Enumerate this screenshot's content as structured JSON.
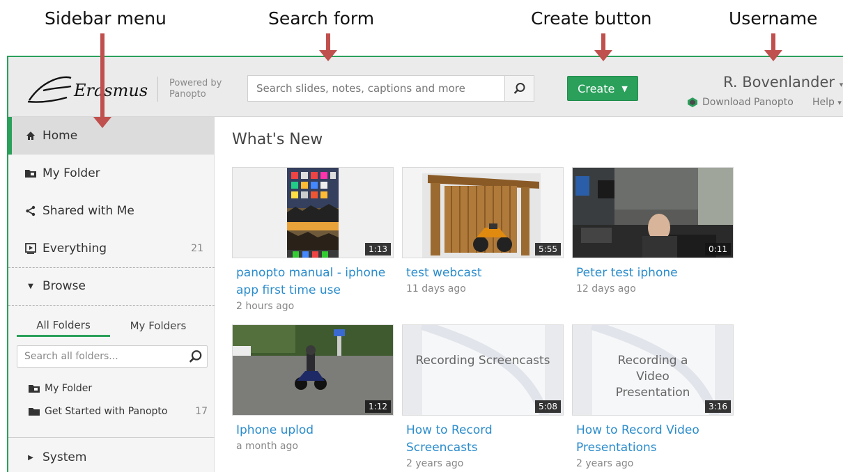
{
  "callouts": {
    "sidebar_menu": "Sidebar menu",
    "search_form": "Search form",
    "create_button": "Create button",
    "username": "Username"
  },
  "colors": {
    "accent": "#2aa05b",
    "link": "#2a8ccc",
    "callout_arrow": "#c0504d"
  },
  "header": {
    "logo_text": "Erasmus",
    "powered_by": "Powered by",
    "powered_brand": "Panopto",
    "search_placeholder": "Search slides, notes, captions and more",
    "create_label": "Create",
    "username": "R. Bovenlander",
    "download_label": "Download Panopto",
    "help_label": "Help"
  },
  "sidebar": {
    "items": [
      {
        "label": "Home",
        "icon": "home-icon"
      },
      {
        "label": "My Folder",
        "icon": "folder-icon"
      },
      {
        "label": "Shared with Me",
        "icon": "share-icon"
      },
      {
        "label": "Everything",
        "icon": "video-icon",
        "count": "21"
      }
    ],
    "browse_label": "Browse",
    "tabs": [
      "All Folders",
      "My Folders"
    ],
    "folder_search_placeholder": "Search all folders...",
    "folders": [
      {
        "label": "My Folder"
      },
      {
        "label": "Get Started with Panopto",
        "count": "17"
      }
    ],
    "system_label": "System"
  },
  "main": {
    "title": "What's New",
    "videos": [
      {
        "title": "panopto manual - iphone app first time use",
        "age": "2 hours ago",
        "duration": "1:13"
      },
      {
        "title": "test webcast",
        "age": "11 days ago",
        "duration": "5:55"
      },
      {
        "title": "Peter test iphone",
        "age": "12 days ago",
        "duration": "0:11"
      },
      {
        "title": "Iphone uplod",
        "age": "a month ago",
        "duration": "1:12"
      },
      {
        "title": "How to Record Screencasts",
        "age": "2 years ago",
        "duration": "5:08",
        "slide_text": "Recording Screencasts"
      },
      {
        "title": "How to Record Video Presentations",
        "age": "2 years ago",
        "duration": "3:16",
        "slide_text": "Recording a Video Presentation"
      }
    ]
  }
}
